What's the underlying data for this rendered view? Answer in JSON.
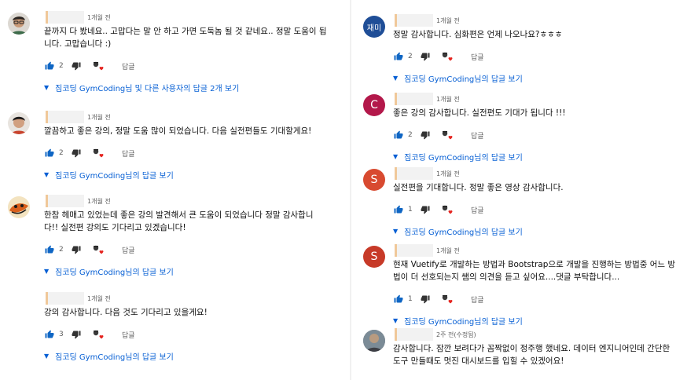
{
  "colors": {
    "link": "#065fd4",
    "muted": "#606060",
    "like": "#0f66c4",
    "heart": "#e5241f"
  },
  "left": [
    {
      "avatar": "photo",
      "time": "1개월 전",
      "text": "끝까지 다 봤네요.. 고맙다는 말 안 하고 가면 도둑놈 될 것 같네요.. 정말 도움이 됩\n니다. 고맙습니다 :)",
      "likes": "2",
      "reply": "답글",
      "replies": "짐코딩 GymCoding님 및 다른 사용자의 답글 2개 보기"
    },
    {
      "avatar": "photo",
      "time": "1개월 전",
      "text": "깔끔하고 좋은 강의, 정말 도움 많이 되었습니다. 다음 실전편들도 기대할게요!",
      "likes": "2",
      "reply": "답글",
      "replies": "짐코딩 GymCoding님의 답글 보기"
    },
    {
      "avatar": "photo",
      "time": "1개월 전",
      "text": "한참 헤매고 있었는데 좋은 강의 발견해서 큰 도움이 되었습니다 정말 감사합니\n다!! 실전편 강의도 기다리고 있겠습니다!",
      "likes": "2",
      "reply": "답글",
      "replies": "짐코딩 GymCoding님의 답글 보기"
    },
    {
      "avatar": "none",
      "time": "1개월 전",
      "text": "강의 감사합니다. 다음 것도 기다리고 있을게요!",
      "likes": "3",
      "reply": "답글",
      "replies": "짐코딩 GymCoding님의 답글 보기"
    }
  ],
  "right": [
    {
      "avatar_text": "재미",
      "avatar_color": "#1f4e97",
      "time": "1개월 전",
      "text": "정말 감사합니다. 심화편은 언제 나오나요?ㅎㅎㅎ",
      "likes": "2",
      "reply": "답글",
      "replies": "짐코딩 GymCoding님의 답글 보기"
    },
    {
      "avatar_text": "C",
      "avatar_color": "#b3184a",
      "time": "1개월 전",
      "text": "좋은 강의 감사합니다. 실전편도 기대가 됩니다 !!!",
      "likes": "2",
      "reply": "답글",
      "replies": "짐코딩 GymCoding님의 답글 보기"
    },
    {
      "avatar_text": "S",
      "avatar_color": "#d84a30",
      "time": "1개월 전",
      "text": "실전편을 기대합니다. 정말 좋은 영상 감사합니다.",
      "likes": "1",
      "reply": "답글",
      "replies": "짐코딩 GymCoding님의 답글 보기"
    },
    {
      "avatar_text": "S",
      "avatar_color": "#c73a28",
      "time": "1개월 전",
      "text": "현재 Vuetify로 개발하는 방법과 Bootstrap으로 개발을 진행하는 방법중 어느 방\n법이 더 선호되는지 쌤의 의견을 듣고 싶어요....댓글 부탁합니다...",
      "likes": "1",
      "reply": "답글",
      "replies": "짐코딩 GymCoding님의 답글 보기"
    },
    {
      "avatar_text": "",
      "avatar_color": "#8a8a8a",
      "time": "2주 전(수정됨)",
      "text": "감사합니다. 잠깐 보려다가 꼼짝없이 정주행 했네요. 데이터 엔지니어인데 간단한\n도구 만들때도 멋진 대시보드를 입힐 수 있겠어요!"
    }
  ]
}
